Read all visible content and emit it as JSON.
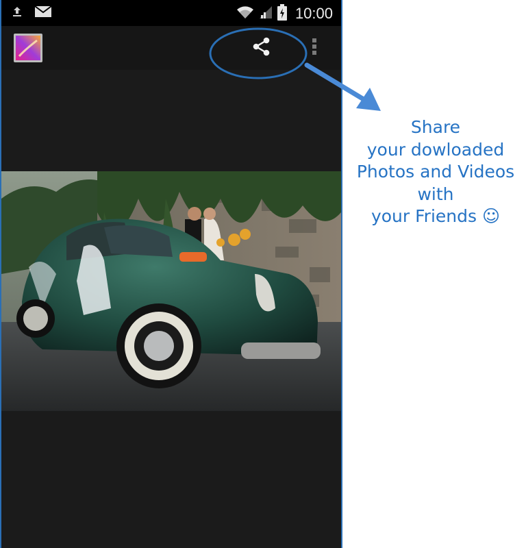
{
  "status_bar": {
    "time": "10:00",
    "icons": [
      "upload-icon",
      "mail-icon",
      "wifi-icon",
      "signal-icon",
      "battery-icon"
    ]
  },
  "action_bar": {
    "app_icon": "gallery-icon",
    "actions": [
      "share-icon",
      "overflow-menu-icon"
    ]
  },
  "content": {
    "photo": "vintage green car with couple (wedding photo)"
  },
  "annotation": {
    "lines": [
      "Share",
      "your dowloaded",
      "Photos and Videos",
      "with",
      "your Friends ☺"
    ],
    "color": "#2673c4"
  },
  "colors": {
    "status_bar": "#000000",
    "action_bar": "#161616",
    "content_bg": "#1b1b1b",
    "accent": "#2a6fb5"
  }
}
